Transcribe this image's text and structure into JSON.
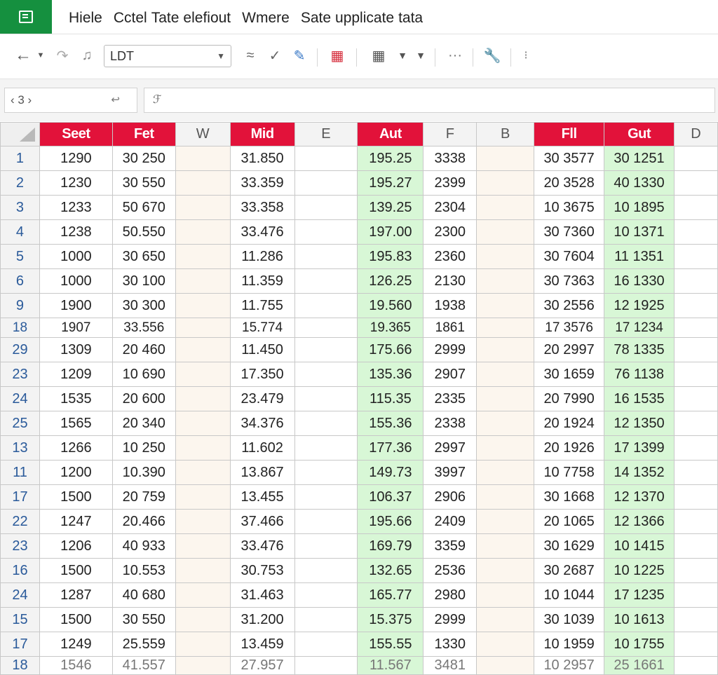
{
  "menubar": {
    "items": [
      "Hiele",
      "Cctel",
      "Tate",
      "elefiout",
      "Wmere",
      "Sate",
      "upplicate",
      "tata"
    ]
  },
  "toolbar": {
    "font_value": "LDT",
    "more_label": "···",
    "extra_label": "⁝"
  },
  "formula_bar": {
    "name_box": "‹ 3 ›",
    "fx_text": "ℱ"
  },
  "grid": {
    "columns": [
      "Seet",
      "Fet",
      "W",
      "Mid",
      "E",
      "Aut",
      "F",
      "B",
      "Fll",
      "Gut",
      "D"
    ],
    "highlight_columns": [
      0,
      1,
      3,
      5,
      8,
      9
    ],
    "rows": [
      {
        "n": "1",
        "cells": [
          "1290",
          "30 250",
          "",
          "31.850",
          "",
          "195.25",
          "3338",
          "",
          "30 3577",
          "30 1251",
          ""
        ]
      },
      {
        "n": "2",
        "cells": [
          "1230",
          "30 550",
          "",
          "33.359",
          "",
          "195.27",
          "2399",
          "",
          "20 3528",
          "40 1330",
          ""
        ]
      },
      {
        "n": "3",
        "cells": [
          "1233",
          "50 670",
          "",
          "33.358",
          "",
          "139.25",
          "2304",
          "",
          "10 3675",
          "10 1895",
          ""
        ]
      },
      {
        "n": "4",
        "cells": [
          "1238",
          "50.550",
          "",
          "33.476",
          "",
          "197.00",
          "2300",
          "",
          "30 7360",
          "10 1371",
          ""
        ]
      },
      {
        "n": "5",
        "cells": [
          "1000",
          "30 650",
          "",
          "11.286",
          "",
          "195.83",
          "2360",
          "",
          "30 7604",
          "11 1351",
          ""
        ]
      },
      {
        "n": "6",
        "cells": [
          "1000",
          "30 100",
          "",
          "11.359",
          "",
          "126.25",
          "2130",
          "",
          "30 7363",
          "16 1330",
          ""
        ]
      },
      {
        "n": "9",
        "cells": [
          "1900",
          "30 300",
          "",
          "11.755",
          "",
          "19.560",
          "1938",
          "",
          "30 2556",
          "12 1925",
          ""
        ]
      },
      {
        "n": "18",
        "cells": [
          "1907",
          "33.556",
          "",
          "15.774",
          "",
          "19.365",
          "1861",
          "",
          "17 3576",
          "17 1234",
          ""
        ]
      },
      {
        "n": "29",
        "cells": [
          "1309",
          "20 460",
          "",
          "11.450",
          "",
          "175.66",
          "2999",
          "",
          "20 2997",
          "78 1335",
          ""
        ]
      },
      {
        "n": "23",
        "cells": [
          "1209",
          "10 690",
          "",
          "17.350",
          "",
          "135.36",
          "2907",
          "",
          "30 1659",
          "76 1138",
          ""
        ]
      },
      {
        "n": "24",
        "cells": [
          "1535",
          "20 600",
          "",
          "23.479",
          "",
          "115.35",
          "2335",
          "",
          "20 7990",
          "16 1535",
          ""
        ]
      },
      {
        "n": "25",
        "cells": [
          "1565",
          "20 340",
          "",
          "34.376",
          "",
          "155.36",
          "2338",
          "",
          "20 1924",
          "12 1350",
          ""
        ]
      },
      {
        "n": "13",
        "cells": [
          "1266",
          "10 250",
          "",
          "11.602",
          "",
          "177.36",
          "2997",
          "",
          "20 1926",
          "17 1399",
          ""
        ]
      },
      {
        "n": "11",
        "cells": [
          "1200",
          "10.390",
          "",
          "13.867",
          "",
          "149.73",
          "3997",
          "",
          "10 7758",
          "14 1352",
          ""
        ]
      },
      {
        "n": "17",
        "cells": [
          "1500",
          "20 759",
          "",
          "13.455",
          "",
          "106.37",
          "2906",
          "",
          "30 1668",
          "12 1370",
          ""
        ]
      },
      {
        "n": "22",
        "cells": [
          "1247",
          "20.466",
          "",
          "37.466",
          "",
          "195.66",
          "2409",
          "",
          "20 1065",
          "12 1366",
          ""
        ]
      },
      {
        "n": "23",
        "cells": [
          "1206",
          "40 933",
          "",
          "33.476",
          "",
          "169.79",
          "3359",
          "",
          "30 1629",
          "10 1415",
          ""
        ]
      },
      {
        "n": "16",
        "cells": [
          "1500",
          "10.553",
          "",
          "30.753",
          "",
          "132.65",
          "2536",
          "",
          "30 2687",
          "10 1225",
          ""
        ]
      },
      {
        "n": "24",
        "cells": [
          "1287",
          "40 680",
          "",
          "31.463",
          "",
          "165.77",
          "2980",
          "",
          "10 1044",
          "17 1235",
          ""
        ]
      },
      {
        "n": "15",
        "cells": [
          "1500",
          "30 550",
          "",
          "31.200",
          "",
          "15.375",
          "2999",
          "",
          "30 1039",
          "10 1613",
          ""
        ]
      },
      {
        "n": "17",
        "cells": [
          "1249",
          "25.559",
          "",
          "13.459",
          "",
          "155.55",
          "1330",
          "",
          "10 1959",
          "10 1755",
          ""
        ]
      },
      {
        "n": "18",
        "cells": [
          "1546",
          "41.557",
          "",
          "27.957",
          "",
          "11.567",
          "3481",
          "",
          "10 2957",
          "25 1661",
          ""
        ]
      }
    ]
  }
}
